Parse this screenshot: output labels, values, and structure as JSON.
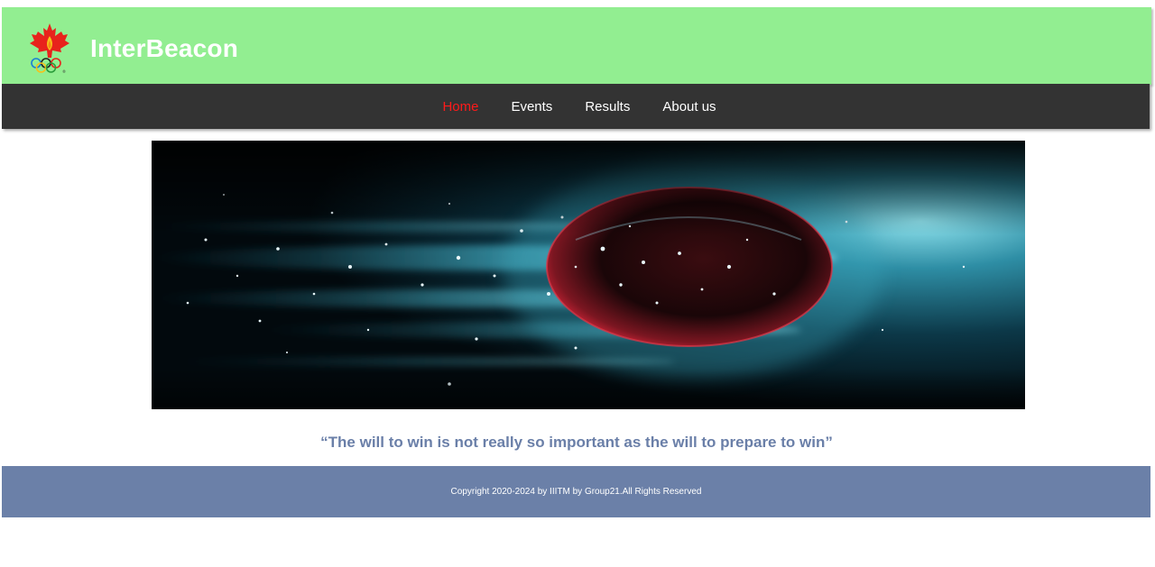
{
  "brand": {
    "title": "InterBeacon",
    "logo_icon": "maple-leaf-olympic-rings-logo"
  },
  "nav": {
    "items": [
      {
        "label": "Home",
        "active": true
      },
      {
        "label": "Events",
        "active": false
      },
      {
        "label": "Results",
        "active": false
      },
      {
        "label": "About us",
        "active": false
      }
    ]
  },
  "hero": {
    "image": "ball-speeding-through-particles"
  },
  "quote": {
    "text": "“The will to win is not really so important as the will to prepare to win”"
  },
  "footer": {
    "text": "Copyright 2020-2024 by IIITM by Group21.All Rights Reserved"
  },
  "colors": {
    "header_bg": "#92ee91",
    "nav_bg": "#333333",
    "nav_active": "#ff1a1a",
    "quote": "#6a7fa8",
    "footer_bg": "#6b80a8"
  }
}
